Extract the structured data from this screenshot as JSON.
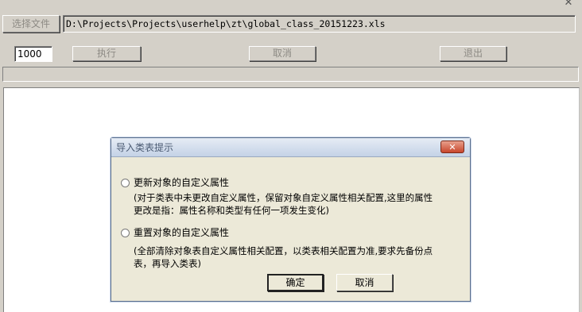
{
  "window": {
    "close_glyph": "✕",
    "icons": {
      "close": "close-icon"
    }
  },
  "toolbar": {
    "select_file_label": "选择文件",
    "file_path": "D:\\Projects\\Projects\\userhelp\\zt\\global_class_20151223.xls",
    "count_value": "1000",
    "execute_label": "执行",
    "cancel_label": "取消",
    "exit_label": "退出"
  },
  "dialog": {
    "title": "导入类表提示",
    "close_glyph": "✕",
    "options": [
      {
        "label": "更新对象的自定义属性",
        "description_line1": "(对于类表中未更改自定义属性，保留对象自定义属性相关配置,这里的属性",
        "description_line2": "更改是指：属性名称和类型有任何一项发生变化)"
      },
      {
        "label": "重置对象的自定义属性",
        "description_line1": "(全部清除对象表自定义属性相关配置，以类表相关配置为准,要求先备份点",
        "description_line2": "表，再导入类表)"
      }
    ],
    "ok_label": "确定",
    "cancel_label": "取消"
  },
  "colors": {
    "face": "#d4d0c8",
    "dialog_face": "#ece9d8",
    "close_red": "#c8462c"
  }
}
